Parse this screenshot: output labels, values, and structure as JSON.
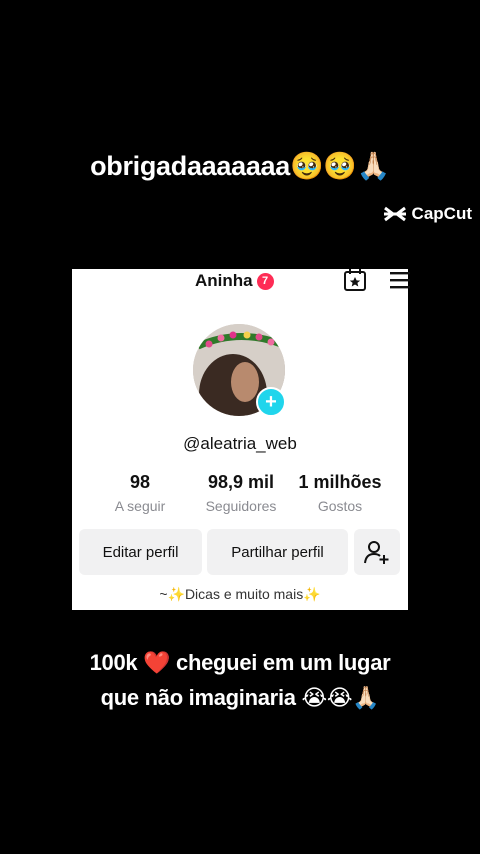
{
  "overlay": {
    "top_caption": "obrigadaaaaaaa🥹🥹🙏🏻",
    "capcut_label": "CapCut",
    "bottom_caption_line1": "100k ❤️ cheguei em um lugar",
    "bottom_caption_line2": "que não imaginaria 😭😭🙏🏻"
  },
  "profile": {
    "name": "Aninha",
    "notification_count": "7",
    "handle": "@aleatria_web",
    "stats": [
      {
        "value": "98",
        "label": "A seguir"
      },
      {
        "value": "98,9 mil",
        "label": "Seguidores"
      },
      {
        "value": "1 milhões",
        "label": "Gostos"
      }
    ],
    "buttons": {
      "edit": "Editar perfil",
      "share": "Partilhar perfil"
    },
    "bio": "~✨Dicas e muito mais✨"
  },
  "icons": {
    "calendar": "calendar-star-icon",
    "menu": "hamburger-menu-icon",
    "add_friend": "add-person-icon",
    "capcut": "capcut-logo-icon"
  },
  "colors": {
    "badge": "#fe2c55",
    "plus": "#20d5ec",
    "button_bg": "#f1f1f2"
  }
}
